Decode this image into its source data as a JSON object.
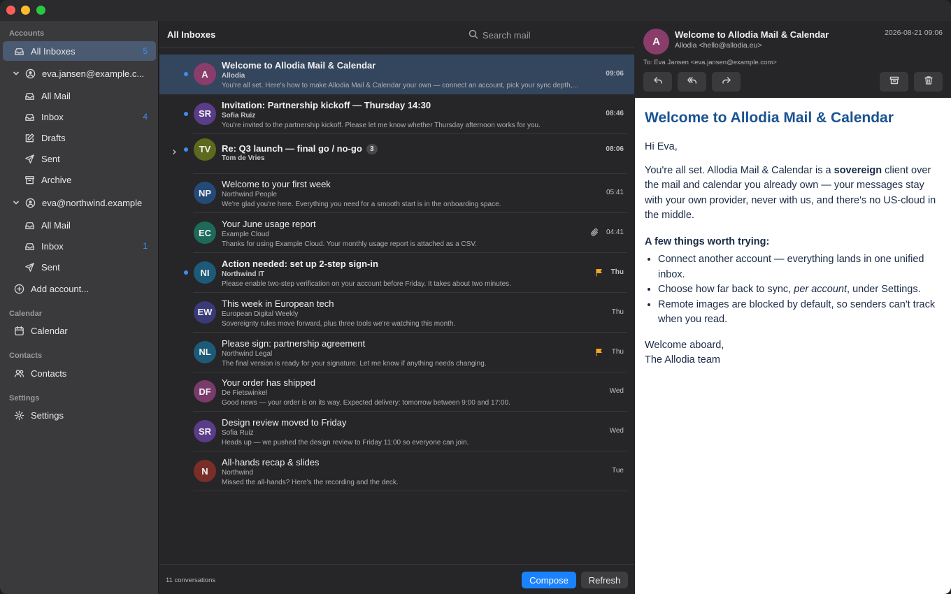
{
  "sidebar": {
    "sections": {
      "accounts": "Accounts",
      "calendar": "Calendar",
      "contacts": "Contacts",
      "settings": "Settings"
    },
    "all_inboxes": {
      "label": "All Inboxes",
      "count": "5"
    },
    "account1": {
      "label": "eva.jansen@example.c...",
      "items": [
        {
          "label": "All Mail",
          "count": ""
        },
        {
          "label": "Inbox",
          "count": "4"
        },
        {
          "label": "Drafts",
          "count": ""
        },
        {
          "label": "Sent",
          "count": ""
        },
        {
          "label": "Archive",
          "count": ""
        }
      ]
    },
    "account2": {
      "label": "eva@northwind.example",
      "items": [
        {
          "label": "All Mail",
          "count": ""
        },
        {
          "label": "Inbox",
          "count": "1"
        },
        {
          "label": "Sent",
          "count": ""
        }
      ]
    },
    "add_account": "Add account...",
    "calendar_item": "Calendar",
    "contacts_item": "Contacts",
    "settings_item": "Settings"
  },
  "list": {
    "title": "All Inboxes",
    "search_placeholder": "Search mail",
    "messages": [
      {
        "initials": "A",
        "color": "#8a3d6a",
        "subject": "Welcome to Allodia Mail & Calendar",
        "sender": "Allodia",
        "preview": "You're all set. Here's how to make Allodia Mail & Calendar your own — connect an account, pick your sync depth,...",
        "time": "09:06",
        "unread": true,
        "selected": true
      },
      {
        "initials": "SR",
        "color": "#5a3c88",
        "subject": "Invitation: Partnership kickoff — Thursday 14:30",
        "sender": "Sofia Ruiz",
        "preview": "You're invited to the partnership kickoff. Please let me know whether Thursday afternoon works for you.",
        "time": "08:46",
        "unread": true
      },
      {
        "initials": "TV",
        "color": "#5d6a1e",
        "subject": "Re: Q3 launch — final go / no-go",
        "thread_count": "3",
        "sender": "Tom de Vries",
        "preview": "",
        "time": "08:06",
        "unread": true,
        "thread": true
      },
      {
        "initials": "NP",
        "color": "#244a78",
        "subject": "Welcome to your first week",
        "sender": "Northwind People",
        "preview": "We're glad you're here. Everything you need for a smooth start is in the onboarding space.",
        "time": "05:41",
        "unread": false
      },
      {
        "initials": "EC",
        "color": "#1d6a5a",
        "subject": "Your June usage report",
        "sender": "Example Cloud",
        "preview": "Thanks for using Example Cloud. Your monthly usage report is attached as a CSV.",
        "time": "04:41",
        "unread": false,
        "attachment": true
      },
      {
        "initials": "NI",
        "color": "#1d5a78",
        "subject": "Action needed: set up 2-step sign-in",
        "sender": "Northwind IT",
        "preview": "Please enable two-step verification on your account before Friday. It takes about two minutes.",
        "time": "Thu",
        "unread": true,
        "flagged": true
      },
      {
        "initials": "EW",
        "color": "#3a3a78",
        "subject": "This week in European tech",
        "sender": "European Digital Weekly",
        "preview": "Sovereignty rules move forward, plus three tools we're watching this month.",
        "time": "Thu",
        "unread": false
      },
      {
        "initials": "NL",
        "color": "#1d5a78",
        "subject": "Please sign: partnership agreement",
        "sender": "Northwind Legal",
        "preview": "The final version is ready for your signature. Let me know if anything needs changing.",
        "time": "Thu",
        "unread": false,
        "flagged": true
      },
      {
        "initials": "DF",
        "color": "#7a3a6a",
        "subject": "Your order has shipped",
        "sender": "De Fietswinkel",
        "preview": "Good news — your order is on its way. Expected delivery: tomorrow between 9:00 and 17:00.",
        "time": "Wed",
        "unread": false
      },
      {
        "initials": "SR",
        "color": "#5a3c88",
        "subject": "Design review moved to Friday",
        "sender": "Sofia Ruiz",
        "preview": "Heads up — we pushed the design review to Friday 11:00 so everyone can join.",
        "time": "Wed",
        "unread": false
      },
      {
        "initials": "N",
        "color": "#7a2e28",
        "subject": "All-hands recap & slides",
        "sender": "Northwind",
        "preview": "Missed the all-hands? Here's the recording and the deck.",
        "time": "Tue",
        "unread": false
      }
    ],
    "footer": {
      "count": "11 conversations",
      "compose": "Compose",
      "refresh": "Refresh"
    }
  },
  "reader": {
    "avatar": "A",
    "subject": "Welcome to Allodia Mail & Calendar",
    "from": "Allodia <hello@allodia.eu>",
    "date": "2026-08-21 09:06",
    "to": "To: Eva Jansen <eva.jansen@example.com>",
    "body": {
      "heading": "Welcome to Allodia Mail & Calendar",
      "greeting": "Hi Eva,",
      "p1_a": "You're all set. Allodia Mail & Calendar is a ",
      "p1_b": "sovereign",
      "p1_c": " client over the mail and calendar you already own — your messages stay with your own provider, never with us, and there's no US-cloud in the middle.",
      "tips_heading": "A few things worth trying:",
      "tip1": "Connect another account — everything lands in one unified inbox.",
      "tip2_a": "Choose how far back to sync, ",
      "tip2_b": "per account",
      "tip2_c": ", under Settings.",
      "tip3": "Remote images are blocked by default, so senders can't track when you read.",
      "signoff1": "Welcome aboard,",
      "signoff2": "The Allodia team"
    }
  }
}
